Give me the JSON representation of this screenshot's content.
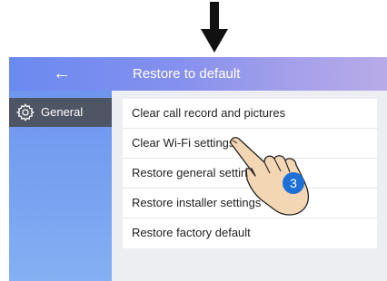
{
  "header": {
    "back_icon": "←",
    "title": "Restore to default"
  },
  "sidebar": {
    "items": [
      {
        "label": "General",
        "icon": "gear-icon"
      }
    ]
  },
  "menu": {
    "items": [
      {
        "label": "Clear call record and pictures"
      },
      {
        "label": "Clear Wi-Fi settings"
      },
      {
        "label": "Restore general settings"
      },
      {
        "label": "Restore installer settings"
      },
      {
        "label": "Restore factory default"
      }
    ]
  },
  "annotation": {
    "step": "3",
    "icons": [
      "down-arrow-icon",
      "pointing-hand-icon"
    ]
  },
  "colors": {
    "header_start": "#6a8af0",
    "header_end": "#b8abe8",
    "sidebar": "#7aa4f1",
    "selected_item": "#4e5565",
    "step_badge": "#1e6fd6"
  }
}
